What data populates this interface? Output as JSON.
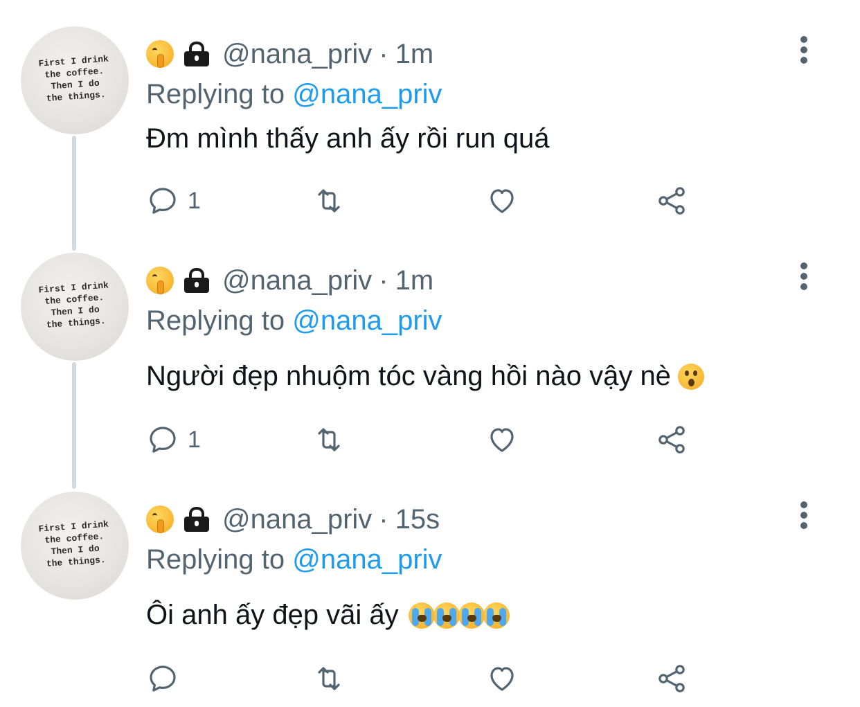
{
  "colors": {
    "text": "#0f1419",
    "secondary": "#536471",
    "mention": "#1d9bf0",
    "thread_line": "#cfd9de"
  },
  "tweets": [
    {
      "avatar_text": [
        "First I drink",
        "the coffee.",
        "Then I do",
        "the things."
      ],
      "header_icons": [
        "shushing-face-emoji",
        "lock-icon"
      ],
      "handle": "@nana_priv",
      "separator": "·",
      "time": "1m",
      "replying_prefix": "Replying to",
      "replying_to": "@nana_priv",
      "text": "Đm mình thấy anh ấy rồi run quá",
      "emoji": [],
      "reply_count": "1"
    },
    {
      "avatar_text": [
        "First I drink",
        "the coffee.",
        "Then I do",
        "the things."
      ],
      "header_icons": [
        "shushing-face-emoji",
        "lock-icon"
      ],
      "handle": "@nana_priv",
      "separator": "·",
      "time": "1m",
      "replying_prefix": "Replying to",
      "replying_to": "@nana_priv",
      "text": "Người đẹp nhuộm tóc vàng hồi nào vậy nè",
      "emoji": [
        "astonished-face-emoji"
      ],
      "reply_count": "1"
    },
    {
      "avatar_text": [
        "First I drink",
        "the coffee.",
        "Then I do",
        "the things."
      ],
      "header_icons": [
        "shushing-face-emoji",
        "lock-icon"
      ],
      "handle": "@nana_priv",
      "separator": "·",
      "time": "15s",
      "replying_prefix": "Replying to",
      "replying_to": "@nana_priv",
      "text": "Ôi anh ấy đẹp vãi ấy",
      "emoji": [
        "loudly-crying-face-emoji",
        "loudly-crying-face-emoji",
        "loudly-crying-face-emoji",
        "loudly-crying-face-emoji"
      ],
      "reply_count": ""
    }
  ],
  "action_icons": [
    "reply-icon",
    "retweet-icon",
    "like-icon",
    "share-icon"
  ]
}
